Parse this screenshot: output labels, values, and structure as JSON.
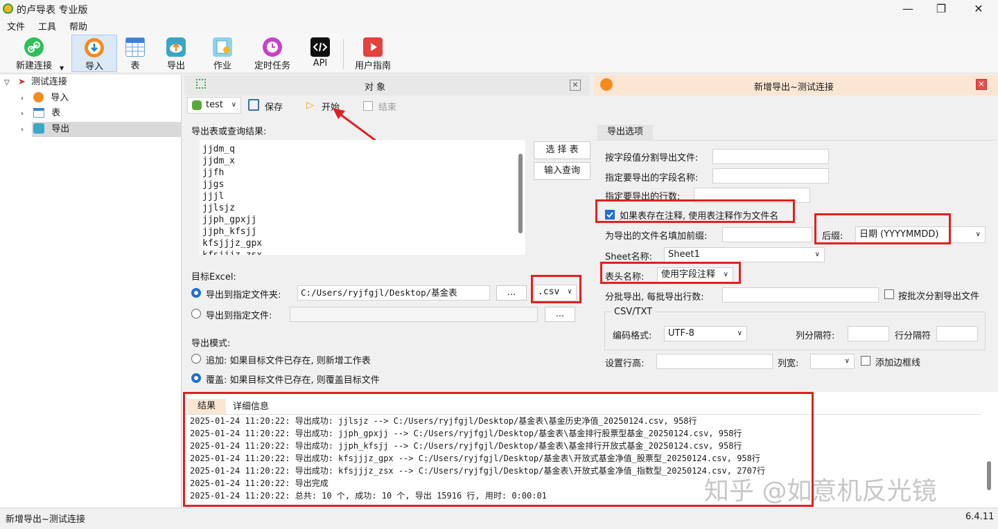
{
  "app": {
    "title": "的卢导表 专业版",
    "minimize": "—",
    "maximize": "❐",
    "close": "✕"
  },
  "menu": [
    "文件",
    "工具",
    "帮助"
  ],
  "toolbar": {
    "new_connection": "新建连接",
    "import": "导入",
    "table": "表",
    "export": "导出",
    "job": "作业",
    "scheduled_task": "定时任务",
    "api": "API",
    "user_guide": "用户指南"
  },
  "tree": {
    "root": "测试连接",
    "children": [
      "导入",
      "表",
      "导出"
    ]
  },
  "left_panel": {
    "header": "对      象",
    "db_select": "test",
    "save": "保存",
    "start": "开始",
    "end": "结束",
    "export_label": "导出表或查询结果:",
    "tables": [
      "jjdm_q",
      "jjdm_x",
      "jjfh",
      "jjgs",
      "jjjl",
      "jjlsjz",
      "jjph_gpxjj",
      "jjph_kfsjj",
      "kfsjjjz_gpx",
      "kfsjjjz_zsx"
    ],
    "select_table": "选 择 表",
    "input_query": "输入查询",
    "target_excel": "目标Excel:",
    "export_to_folder": "导出到指定文件夹:",
    "folder_path": "C:/Users/ryjfgjl/Desktop/基金表",
    "browse": "...",
    "ext": ".csv",
    "export_to_file": "导出到指定文件:",
    "export_mode": "导出模式:",
    "append": "追加: 如果目标文件已存在, 则新增工作表",
    "overwrite": "覆盖: 如果目标文件已存在, 则覆盖目标文件"
  },
  "right_panel": {
    "title": "新增导出~测试连接",
    "tab": "导出选项",
    "split_by_field": "按字段值分割导出文件:",
    "field_names": "指定要导出的字段名称:",
    "row_count": "指定要导出的行数:",
    "use_comment": "如果表存在注释, 使用表注释作为文件名",
    "prefix": "为导出的文件名填加前缀:",
    "suffix_label": "后缀:",
    "suffix_value": "日期 (YYYYMMDD)",
    "sheet_label": "Sheet名称:",
    "sheet_value": "Sheet1",
    "header_label": "表头名称:",
    "header_value": "使用字段注释",
    "batch_label": "分批导出, 每批导出行数:",
    "batch_split": "按批次分割导出文件",
    "csv_group": "CSV/TXT",
    "encoding_label": "编码格式:",
    "encoding_value": "UTF-8",
    "col_sep": "列分隔符:",
    "row_sep": "行分隔符",
    "row_height": "设置行高:",
    "col_width": "列宽:",
    "border": "添加边框线"
  },
  "results": {
    "tabs": [
      "结果",
      "详细信息"
    ],
    "lines": [
      "2025-01-24 11:20:22: 导出成功: jjlsjz --> C:/Users/ryjfgjl/Desktop/基金表\\基金历史净值_20250124.csv, 958行",
      "2025-01-24 11:20:22: 导出成功: jjph_gpxjj --> C:/Users/ryjfgjl/Desktop/基金表\\基金排行股票型基金_20250124.csv, 958行",
      "2025-01-24 11:20:22: 导出成功: jjph_kfsjj --> C:/Users/ryjfgjl/Desktop/基金表\\基金排行开放式基金_20250124.csv, 958行",
      "2025-01-24 11:20:22: 导出成功: kfsjjjz_gpx --> C:/Users/ryjfgjl/Desktop/基金表\\开放式基金净值_股票型_20250124.csv, 958行",
      "2025-01-24 11:20:22: 导出成功: kfsjjjz_zsx --> C:/Users/ryjfgjl/Desktop/基金表\\开放式基金净值_指数型_20250124.csv, 2707行",
      "2025-01-24 11:20:22: 导出完成",
      "2025-01-24 11:20:22: 总共: 10 个, 成功: 10 个, 导出 15916 行, 用时: 0:00:01"
    ]
  },
  "watermark": "知乎 @如意机反光镜",
  "status": {
    "left": "新增导出~测试连接",
    "version": "6.4.11"
  }
}
